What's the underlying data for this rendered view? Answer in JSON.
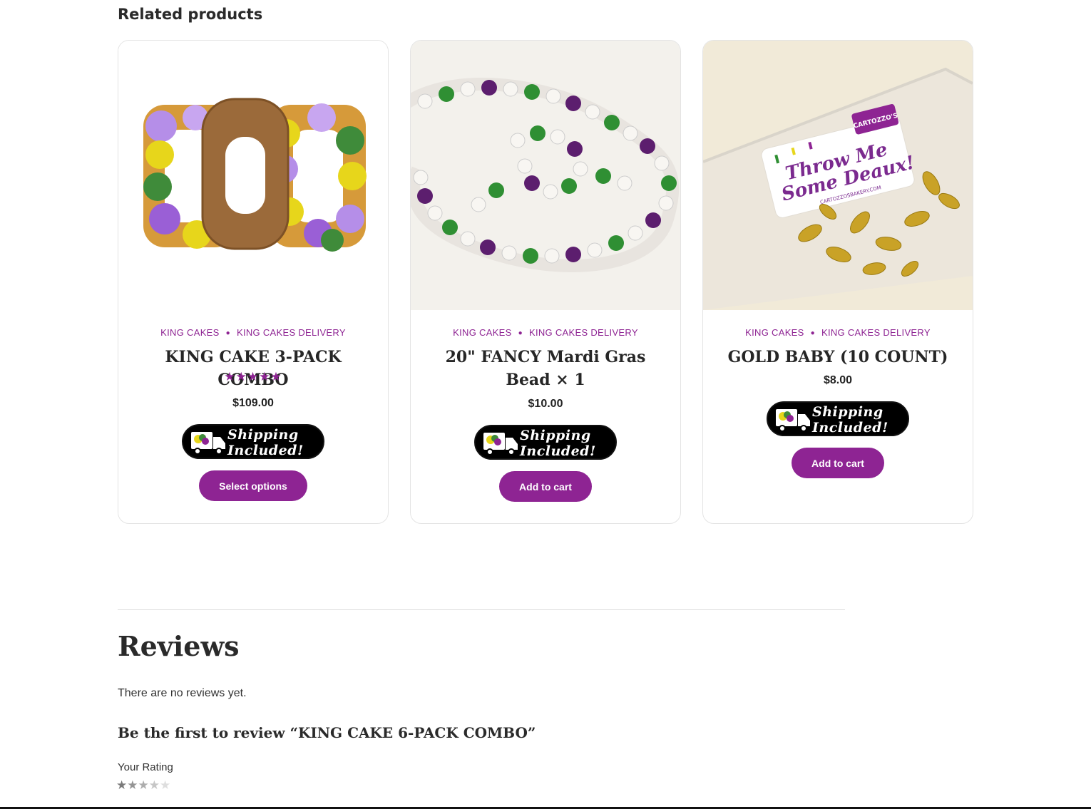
{
  "related": {
    "title": "Related products"
  },
  "products": [
    {
      "categories": [
        "KING CAKES",
        "KING CAKES DELIVERY"
      ],
      "name": "KING CAKE 3-PACK COMBO",
      "rating": "★★★★★",
      "rating_value": 5,
      "price": "$109.00",
      "shipping_badge": [
        "Shipping",
        "Included!"
      ],
      "button": "Select options"
    },
    {
      "categories": [
        "KING CAKES",
        "KING CAKES DELIVERY"
      ],
      "name": "20\" FANCY Mardi Gras Bead × 1",
      "price": "$10.00",
      "shipping_badge": [
        "Shipping",
        "Included!"
      ],
      "button": "Add to cart"
    },
    {
      "categories": [
        "KING CAKES",
        "KING CAKES DELIVERY"
      ],
      "name": "GOLD BABY (10 COUNT)",
      "price": "$8.00",
      "shipping_badge": [
        "Shipping",
        "Included!"
      ],
      "button": "Add to cart",
      "image_text": [
        "Throw Me",
        "Some Deaux!",
        "CARTOZZO'S",
        "CARTOZZOSBAKERY.COM"
      ]
    }
  ],
  "reviews": {
    "heading": "Reviews",
    "empty_text": "There are no reviews yet.",
    "first_review": "Be the first to review “KING CAKE 6-PACK COMBO”",
    "rating_label": "Your Rating",
    "rating_stars": "★★★★★"
  },
  "colors": {
    "accent": "#8e2493",
    "text": "#262626",
    "border": "#e4e4e4"
  }
}
